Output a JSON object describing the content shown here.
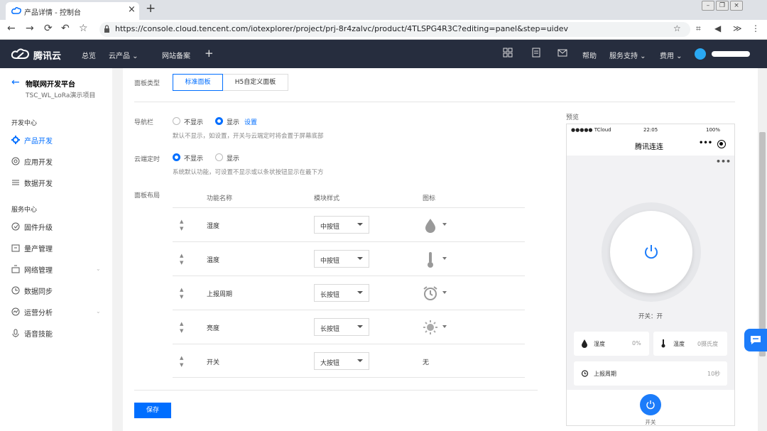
{
  "browser": {
    "tab_title": "产品详情 - 控制台",
    "url": "https://console.cloud.tencent.com/iotexplorer/project/prj-8r4zalvc/product/4TLSPG4R3C?editing=panel&step=uidev"
  },
  "topnav": {
    "brand": "腾讯云",
    "items": [
      "总览",
      "云产品 ⌄",
      "网站备案"
    ],
    "plus": "+",
    "right": [
      "帮助",
      "服务支持 ⌄",
      "费用 ⌄"
    ]
  },
  "sidebar": {
    "title": "物联网开发平台",
    "project": "TSC_WL_LoRa演示项目",
    "group1": "开发中心",
    "dev_items": [
      "产品开发",
      "应用开发",
      "数据开发"
    ],
    "group2": "服务中心",
    "svc_items": [
      "固件升级",
      "量产管理",
      "网络管理",
      "数据同步",
      "运营分析",
      "语音技能"
    ]
  },
  "panel": {
    "type_label": "面板类型",
    "type_tabs": [
      "标准面板",
      "H5自定义面板"
    ],
    "nav_label": "导航栏",
    "nav_options": [
      "不显示",
      "显示"
    ],
    "nav_link": "设置",
    "nav_hint": "默认不显示，如设置，开关与云端定时将会置于屏幕底部",
    "timer_label": "云端定时",
    "timer_options": [
      "不显示",
      "显示"
    ],
    "timer_hint": "系统默认功能，可设置不显示或以条状按钮显示在最下方",
    "layout_label": "面板布局",
    "headers": [
      "功能名称",
      "模块样式",
      "图标"
    ],
    "rows": [
      {
        "name": "湿度",
        "style": "中按钮",
        "icon": "drop-icon"
      },
      {
        "name": "温度",
        "style": "中按钮",
        "icon": "thermometer-icon"
      },
      {
        "name": "上报周期",
        "style": "长按钮",
        "icon": "alarm-clock-icon"
      },
      {
        "name": "亮度",
        "style": "长按钮",
        "icon": "sun-icon"
      },
      {
        "name": "开关",
        "style": "大按钮",
        "icon_text": "无"
      }
    ],
    "save": "保存"
  },
  "preview": {
    "label": "预览",
    "signal": "●●●●● TCloud",
    "time": "22:05",
    "battery": "100%",
    "title": "腾讯连连",
    "dots": "•••",
    "more": "•••",
    "switch_state": "开关：开",
    "cards": [
      {
        "name": "湿度",
        "value": "0%"
      },
      {
        "name": "温度",
        "value": "0摄氏度"
      },
      {
        "name": "上报周期",
        "value": "10秒"
      }
    ],
    "bottom_label": "开关"
  },
  "colors": {
    "accent": "#006eff",
    "nav_bg": "#262d3e"
  }
}
